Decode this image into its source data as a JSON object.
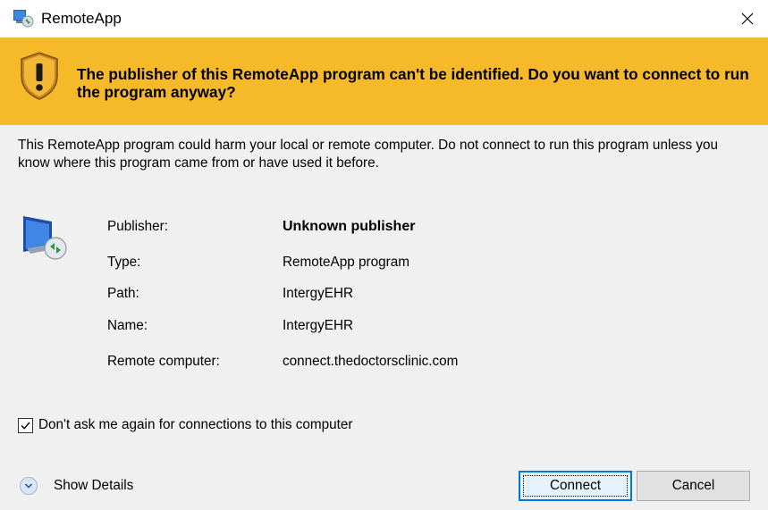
{
  "window": {
    "title": "RemoteApp",
    "close_glyph": "✕"
  },
  "banner": {
    "message": "The publisher of this RemoteApp program can't be identified. Do you want to connect to run the program anyway?",
    "background": "#f5b92a"
  },
  "warning": "This RemoteApp program could harm your local or remote computer. Do not connect to run this program unless you know where this program came from or have used it before.",
  "details": {
    "publisher_label": "Publisher:",
    "publisher_value": "Unknown publisher",
    "type_label": "Type:",
    "type_value": "RemoteApp program",
    "path_label": "Path:",
    "path_value": "IntergyEHR",
    "name_label": "Name:",
    "name_value": "IntergyEHR",
    "remote_label": "Remote computer:",
    "remote_value": "connect.thedoctorsclinic.com"
  },
  "dont_ask": {
    "label": "Don't ask me again for connections to this computer",
    "checked": true
  },
  "show_details_label": "Show Details",
  "buttons": {
    "connect": "Connect",
    "cancel": "Cancel"
  },
  "colors": {
    "accent": "#0078d7",
    "dialog_bg": "#f0f0f0"
  }
}
